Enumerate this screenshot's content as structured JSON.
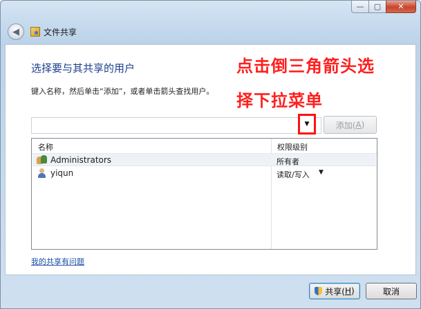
{
  "window": {
    "title": "文件共享",
    "minimize_symbol": "—",
    "maximize_symbol": "▢",
    "close_symbol": "✕",
    "back_symbol": "◀"
  },
  "main": {
    "heading": "选择要与其共享的用户",
    "instruction": "键入名称，然后单击“添加”，或者单击箭头查找用户。",
    "annotation_line1": "点击倒三角箭头选",
    "annotation_line2": "择下拉菜单",
    "combo": {
      "value": "",
      "arrow_symbol": "▼"
    },
    "add_button": {
      "label": "添加(",
      "accel": "A",
      "suffix": ")"
    },
    "table": {
      "columns": [
        "名称",
        "权限级别"
      ],
      "rows": [
        {
          "name": "Administrators",
          "permission": "所有者",
          "arrow": "",
          "icon": "users-group-icon"
        },
        {
          "name": "yiqun",
          "permission": "读取/写入",
          "arrow": "▼",
          "icon": "user-icon"
        }
      ]
    },
    "help_link": "我的共享有问题"
  },
  "footer": {
    "share_button": {
      "label": "共享(",
      "accel": "H",
      "suffix": ")"
    },
    "cancel_button": "取消"
  },
  "colors": {
    "heading": "#1c3d8c",
    "annotation": "#ff1f1f",
    "highlight_box": "#ff1010",
    "link": "#1a4fa8"
  }
}
